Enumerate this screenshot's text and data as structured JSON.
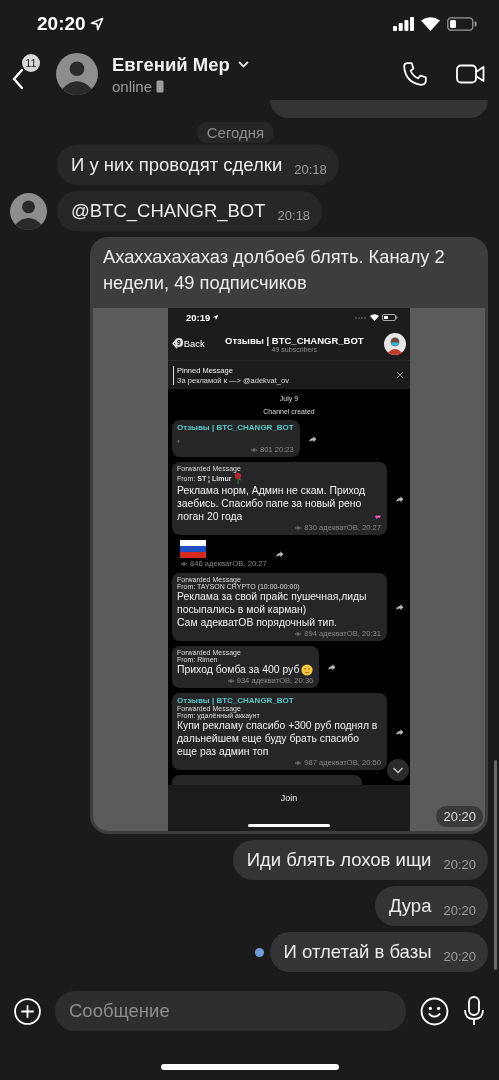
{
  "status_bar": {
    "time": "20:20"
  },
  "header": {
    "back_badge": "11",
    "name": "Евгений Мер",
    "status": "online"
  },
  "date_divider": "Сегодня",
  "messages": [
    {
      "kind": "partial",
      "outgoing": true,
      "unread": false
    },
    {
      "kind": "text",
      "outgoing": false,
      "text": "И у них проводят сделки",
      "time": "20:18",
      "avatar": false,
      "unread": false
    },
    {
      "kind": "text",
      "outgoing": false,
      "text": "@BTC_CHANGR_BOT",
      "time": "20:18",
      "avatar": true,
      "unread": false
    },
    {
      "kind": "photo",
      "outgoing": true,
      "text": "Ахаххахахахаз долбоеб блять. Каналу 2 недели, 49 подписчиков",
      "time": "20:20",
      "unread": false,
      "screenshot": {
        "time": "20:19",
        "back_badge": "9",
        "back_label": "Back",
        "title": "Отзывы | BTC_CHANGR_BOT",
        "subtitle": "49 subscribers",
        "pinned": {
          "label": "Pinned Message",
          "text": "За рекламой к —> @adekvat_ov"
        },
        "date": "July 9",
        "service": "Channel created",
        "posts": [
          {
            "kind": "text",
            "channel": "Отзывы | BTC_CHANGR_BOT",
            "text": ".",
            "meta": "801 20:23"
          },
          {
            "kind": "text",
            "forwarded": "Forwarded Message",
            "from": "From: **ST ¦ Limur**",
            "from_emoji": {
              "kind": "rose"
            },
            "text": "Реклама норм, Админ не скам. Приход заебись. Спасибо папе за новый рено логан 20 года",
            "emoji": {
              "kind": "hearts"
            },
            "meta": "830 адекватОВ, 20:27"
          },
          {
            "kind": "flag",
            "meta": "846 адекватОВ, 20:27"
          },
          {
            "kind": "text",
            "forwarded": "Forwarded Message",
            "from": "From: TAYSON CRYPTO (10:00-00:00)",
            "text": "Реклама за свой прайс пушечная,лиды посыпались в мой карман)\nСам адекватОВ порядочный тип.",
            "meta": "894 адекватОВ, 20:31"
          },
          {
            "kind": "text",
            "forwarded": "Forwarded Message",
            "from": "From: Rimen",
            "text": "Приход бомба за 400 руб",
            "emoji": {
              "kind": "face"
            },
            "meta": "934 адекватОВ, 20:36"
          },
          {
            "kind": "text",
            "channel": "Отзывы | BTC_CHANGR_BOT",
            "forwarded": "Forwarded Message",
            "from": "From: удалённый аккаунт",
            "text": "Купи рекламу спасибо +300 руб поднял в дальнейшем еще буду брать спасибо еще раз админ топ",
            "meta": "987 адекватОВ, 20:50"
          },
          {
            "kind": "partial"
          }
        ],
        "join": "Join"
      }
    },
    {
      "kind": "text",
      "outgoing": true,
      "text": "Иди блять лохов ищи",
      "time": "20:20",
      "unread": false
    },
    {
      "kind": "text",
      "outgoing": true,
      "text": "Дура",
      "time": "20:20",
      "unread": false
    },
    {
      "kind": "text",
      "outgoing": true,
      "text": "И отлетай в базы",
      "time": "20:20",
      "unread": true
    }
  ],
  "composer": {
    "placeholder": "Сообщение"
  }
}
